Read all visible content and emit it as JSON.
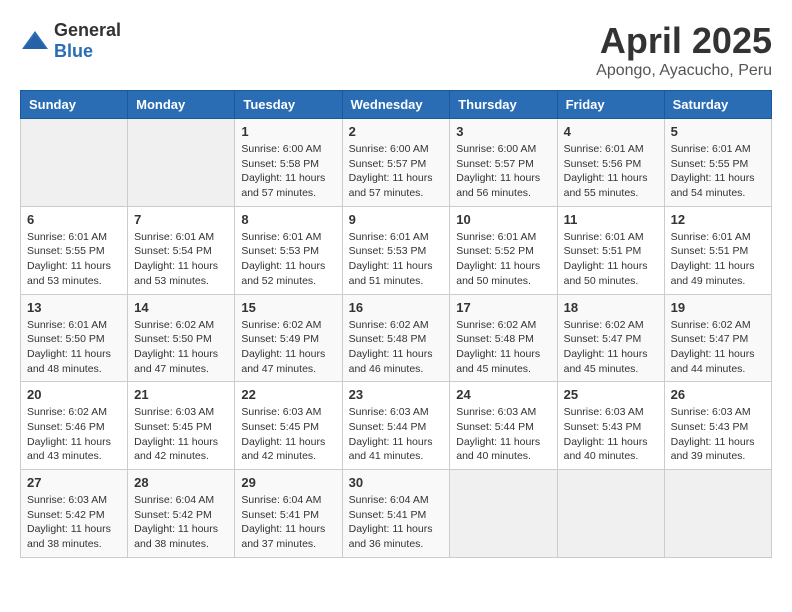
{
  "logo": {
    "text_general": "General",
    "text_blue": "Blue"
  },
  "title": "April 2025",
  "location": "Apongo, Ayacucho, Peru",
  "weekdays": [
    "Sunday",
    "Monday",
    "Tuesday",
    "Wednesday",
    "Thursday",
    "Friday",
    "Saturday"
  ],
  "weeks": [
    [
      {
        "day": "",
        "empty": true
      },
      {
        "day": "",
        "empty": true
      },
      {
        "day": "1",
        "sunrise": "Sunrise: 6:00 AM",
        "sunset": "Sunset: 5:58 PM",
        "daylight": "Daylight: 11 hours and 57 minutes."
      },
      {
        "day": "2",
        "sunrise": "Sunrise: 6:00 AM",
        "sunset": "Sunset: 5:57 PM",
        "daylight": "Daylight: 11 hours and 57 minutes."
      },
      {
        "day": "3",
        "sunrise": "Sunrise: 6:00 AM",
        "sunset": "Sunset: 5:57 PM",
        "daylight": "Daylight: 11 hours and 56 minutes."
      },
      {
        "day": "4",
        "sunrise": "Sunrise: 6:01 AM",
        "sunset": "Sunset: 5:56 PM",
        "daylight": "Daylight: 11 hours and 55 minutes."
      },
      {
        "day": "5",
        "sunrise": "Sunrise: 6:01 AM",
        "sunset": "Sunset: 5:55 PM",
        "daylight": "Daylight: 11 hours and 54 minutes."
      }
    ],
    [
      {
        "day": "6",
        "sunrise": "Sunrise: 6:01 AM",
        "sunset": "Sunset: 5:55 PM",
        "daylight": "Daylight: 11 hours and 53 minutes."
      },
      {
        "day": "7",
        "sunrise": "Sunrise: 6:01 AM",
        "sunset": "Sunset: 5:54 PM",
        "daylight": "Daylight: 11 hours and 53 minutes."
      },
      {
        "day": "8",
        "sunrise": "Sunrise: 6:01 AM",
        "sunset": "Sunset: 5:53 PM",
        "daylight": "Daylight: 11 hours and 52 minutes."
      },
      {
        "day": "9",
        "sunrise": "Sunrise: 6:01 AM",
        "sunset": "Sunset: 5:53 PM",
        "daylight": "Daylight: 11 hours and 51 minutes."
      },
      {
        "day": "10",
        "sunrise": "Sunrise: 6:01 AM",
        "sunset": "Sunset: 5:52 PM",
        "daylight": "Daylight: 11 hours and 50 minutes."
      },
      {
        "day": "11",
        "sunrise": "Sunrise: 6:01 AM",
        "sunset": "Sunset: 5:51 PM",
        "daylight": "Daylight: 11 hours and 50 minutes."
      },
      {
        "day": "12",
        "sunrise": "Sunrise: 6:01 AM",
        "sunset": "Sunset: 5:51 PM",
        "daylight": "Daylight: 11 hours and 49 minutes."
      }
    ],
    [
      {
        "day": "13",
        "sunrise": "Sunrise: 6:01 AM",
        "sunset": "Sunset: 5:50 PM",
        "daylight": "Daylight: 11 hours and 48 minutes."
      },
      {
        "day": "14",
        "sunrise": "Sunrise: 6:02 AM",
        "sunset": "Sunset: 5:50 PM",
        "daylight": "Daylight: 11 hours and 47 minutes."
      },
      {
        "day": "15",
        "sunrise": "Sunrise: 6:02 AM",
        "sunset": "Sunset: 5:49 PM",
        "daylight": "Daylight: 11 hours and 47 minutes."
      },
      {
        "day": "16",
        "sunrise": "Sunrise: 6:02 AM",
        "sunset": "Sunset: 5:48 PM",
        "daylight": "Daylight: 11 hours and 46 minutes."
      },
      {
        "day": "17",
        "sunrise": "Sunrise: 6:02 AM",
        "sunset": "Sunset: 5:48 PM",
        "daylight": "Daylight: 11 hours and 45 minutes."
      },
      {
        "day": "18",
        "sunrise": "Sunrise: 6:02 AM",
        "sunset": "Sunset: 5:47 PM",
        "daylight": "Daylight: 11 hours and 45 minutes."
      },
      {
        "day": "19",
        "sunrise": "Sunrise: 6:02 AM",
        "sunset": "Sunset: 5:47 PM",
        "daylight": "Daylight: 11 hours and 44 minutes."
      }
    ],
    [
      {
        "day": "20",
        "sunrise": "Sunrise: 6:02 AM",
        "sunset": "Sunset: 5:46 PM",
        "daylight": "Daylight: 11 hours and 43 minutes."
      },
      {
        "day": "21",
        "sunrise": "Sunrise: 6:03 AM",
        "sunset": "Sunset: 5:45 PM",
        "daylight": "Daylight: 11 hours and 42 minutes."
      },
      {
        "day": "22",
        "sunrise": "Sunrise: 6:03 AM",
        "sunset": "Sunset: 5:45 PM",
        "daylight": "Daylight: 11 hours and 42 minutes."
      },
      {
        "day": "23",
        "sunrise": "Sunrise: 6:03 AM",
        "sunset": "Sunset: 5:44 PM",
        "daylight": "Daylight: 11 hours and 41 minutes."
      },
      {
        "day": "24",
        "sunrise": "Sunrise: 6:03 AM",
        "sunset": "Sunset: 5:44 PM",
        "daylight": "Daylight: 11 hours and 40 minutes."
      },
      {
        "day": "25",
        "sunrise": "Sunrise: 6:03 AM",
        "sunset": "Sunset: 5:43 PM",
        "daylight": "Daylight: 11 hours and 40 minutes."
      },
      {
        "day": "26",
        "sunrise": "Sunrise: 6:03 AM",
        "sunset": "Sunset: 5:43 PM",
        "daylight": "Daylight: 11 hours and 39 minutes."
      }
    ],
    [
      {
        "day": "27",
        "sunrise": "Sunrise: 6:03 AM",
        "sunset": "Sunset: 5:42 PM",
        "daylight": "Daylight: 11 hours and 38 minutes."
      },
      {
        "day": "28",
        "sunrise": "Sunrise: 6:04 AM",
        "sunset": "Sunset: 5:42 PM",
        "daylight": "Daylight: 11 hours and 38 minutes."
      },
      {
        "day": "29",
        "sunrise": "Sunrise: 6:04 AM",
        "sunset": "Sunset: 5:41 PM",
        "daylight": "Daylight: 11 hours and 37 minutes."
      },
      {
        "day": "30",
        "sunrise": "Sunrise: 6:04 AM",
        "sunset": "Sunset: 5:41 PM",
        "daylight": "Daylight: 11 hours and 36 minutes."
      },
      {
        "day": "",
        "empty": true
      },
      {
        "day": "",
        "empty": true
      },
      {
        "day": "",
        "empty": true
      }
    ]
  ]
}
